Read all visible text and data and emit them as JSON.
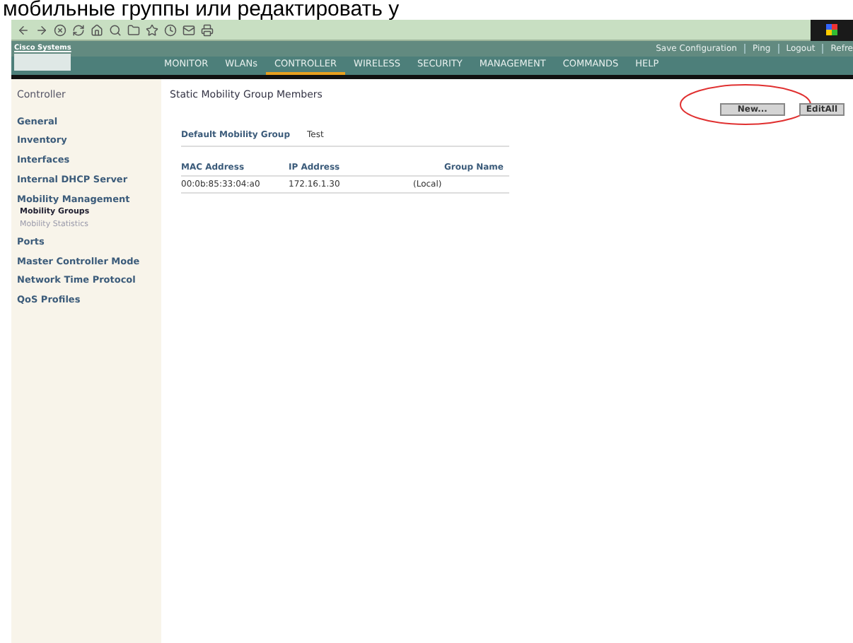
{
  "caption": "мобильные группы или редактировать у",
  "brand": "Cisco Systems",
  "top_links": [
    "Save Configuration",
    "Ping",
    "Logout",
    "Refre"
  ],
  "nav": [
    {
      "label": "MONITOR",
      "selected": false
    },
    {
      "label": "WLANs",
      "selected": false
    },
    {
      "label": "CONTROLLER",
      "selected": true
    },
    {
      "label": "WIRELESS",
      "selected": false
    },
    {
      "label": "SECURITY",
      "selected": false
    },
    {
      "label": "MANAGEMENT",
      "selected": false
    },
    {
      "label": "COMMANDS",
      "selected": false
    },
    {
      "label": "HELP",
      "selected": false
    }
  ],
  "sidebar": {
    "title": "Controller",
    "items": [
      {
        "label": "General"
      },
      {
        "label": "Inventory"
      },
      {
        "label": "Interfaces"
      },
      {
        "label": "Internal DHCP Server"
      },
      {
        "label": "Mobility Management",
        "children": [
          {
            "label": "Mobility Groups",
            "selected": true
          },
          {
            "label": "Mobility Statistics",
            "selected": false
          }
        ]
      },
      {
        "label": "Ports"
      },
      {
        "label": "Master Controller Mode"
      },
      {
        "label": "Network Time Protocol"
      },
      {
        "label": "QoS Profiles"
      }
    ]
  },
  "page_title": "Static Mobility Group Members",
  "buttons": [
    {
      "label": "New...",
      "highlighted": true
    },
    {
      "label": "EditAll",
      "highlighted": false
    }
  ],
  "default_group": {
    "label": "Default Mobility Group",
    "value": "Test"
  },
  "table": {
    "columns": [
      "MAC Address",
      "IP Address",
      "Group Name"
    ],
    "rows": [
      [
        "00:0b:85:33:04:a0",
        "172.16.1.30",
        "(Local)"
      ]
    ]
  }
}
